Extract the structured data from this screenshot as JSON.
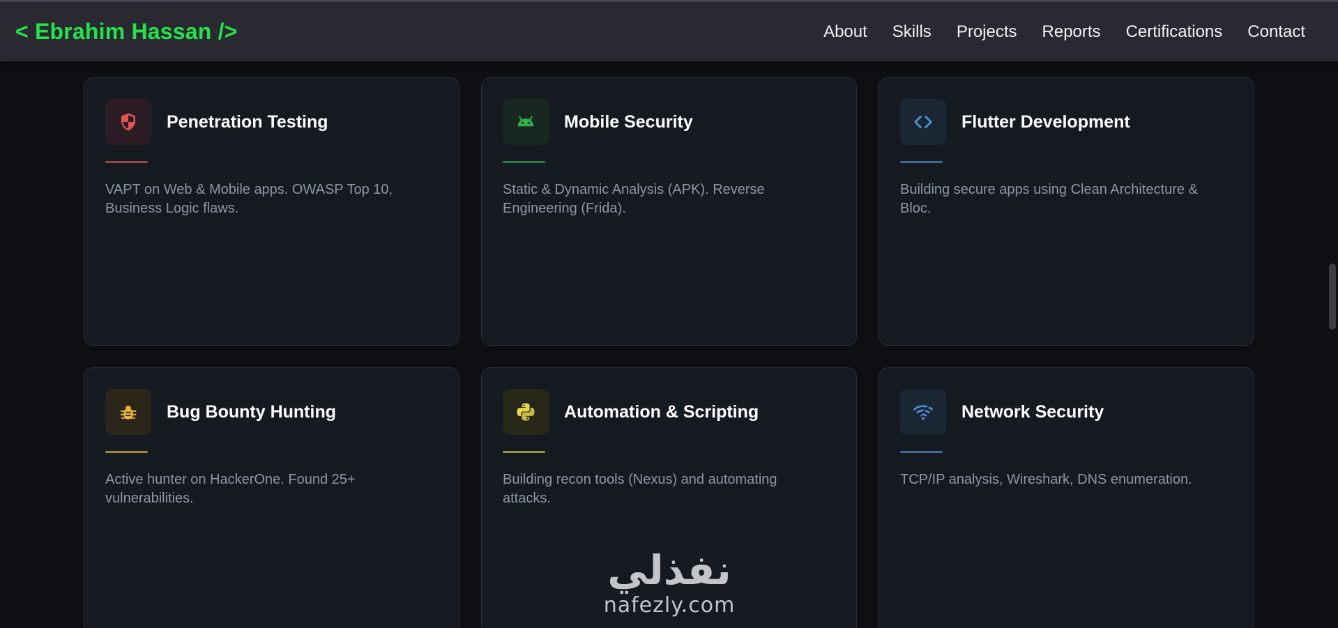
{
  "header": {
    "logo": "< Ebrahim Hassan />",
    "nav": [
      "About",
      "Skills",
      "Projects",
      "Reports",
      "Certifications",
      "Contact"
    ]
  },
  "cards": [
    {
      "title": "Penetration Testing",
      "desc": "VAPT on Web & Mobile apps. OWASP Top 10, Business Logic flaws.",
      "icon": "shield-icon",
      "accent": "#e05555",
      "icon_bg": "#2a1c22"
    },
    {
      "title": "Mobile Security",
      "desc": "Static & Dynamic Analysis (APK). Reverse Engineering (Frida).",
      "icon": "android-icon",
      "accent": "#2fae4a",
      "icon_bg": "#18271f"
    },
    {
      "title": "Flutter Development",
      "desc": "Building secure apps using Clean Architecture & Bloc.",
      "icon": "code-icon",
      "accent": "#4f8fd6",
      "icon_bg": "#1b2635"
    },
    {
      "title": "Bug Bounty Hunting",
      "desc": "Active hunter on HackerOne. Found 25+ vulnerabilities.",
      "icon": "bug-icon",
      "accent": "#e3b43c",
      "icon_bg": "#2a2419"
    },
    {
      "title": "Automation & Scripting",
      "desc": "Building recon tools (Nexus) and automating attacks.",
      "icon": "python-icon",
      "accent": "#d7c84a",
      "icon_bg": "#262619"
    },
    {
      "title": "Network Security",
      "desc": "TCP/IP analysis, Wireshark, DNS enumeration.",
      "icon": "wifi-icon",
      "accent": "#4f8fd6",
      "icon_bg": "#1b2635"
    }
  ],
  "watermark": {
    "arabic": "نفذلي",
    "latin": "nafezly.com"
  }
}
